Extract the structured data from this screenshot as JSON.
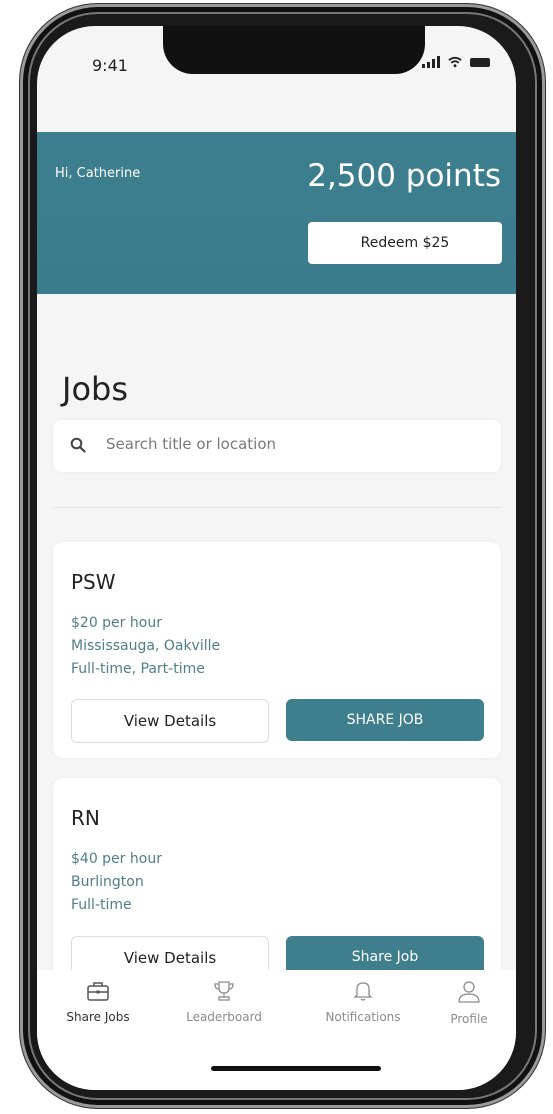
{
  "status_bar": {
    "time": "9:41"
  },
  "header": {
    "greeting": "Hi, Catherine",
    "points": "2,500 points",
    "redeem_label": "Redeem $25"
  },
  "jobs": {
    "title": "Jobs",
    "search_placeholder": "Search title or location",
    "cards": [
      {
        "title": "PSW",
        "pay": "$20 per hour",
        "location": "Mississauga, Oakville",
        "type": "Full-time, Part-time",
        "details_label": "View Details",
        "share_label": "SHARE JOB"
      },
      {
        "title": "RN",
        "pay": "$40 per hour",
        "location": "Burlington",
        "type": "Full-time",
        "details_label": "View Details",
        "share_label": "Share Job"
      }
    ]
  },
  "tabbar": {
    "items": [
      {
        "label": "Share Jobs",
        "icon": "briefcase-icon",
        "active": true
      },
      {
        "label": "Leaderboard",
        "icon": "trophy-icon",
        "active": false
      },
      {
        "label": "Notifications",
        "icon": "bell-icon",
        "active": false
      },
      {
        "label": "Profile",
        "icon": "user-icon",
        "active": false
      }
    ]
  },
  "colors": {
    "accent": "#3f7e8d",
    "background": "#f5f5f5",
    "text": "#222222"
  }
}
